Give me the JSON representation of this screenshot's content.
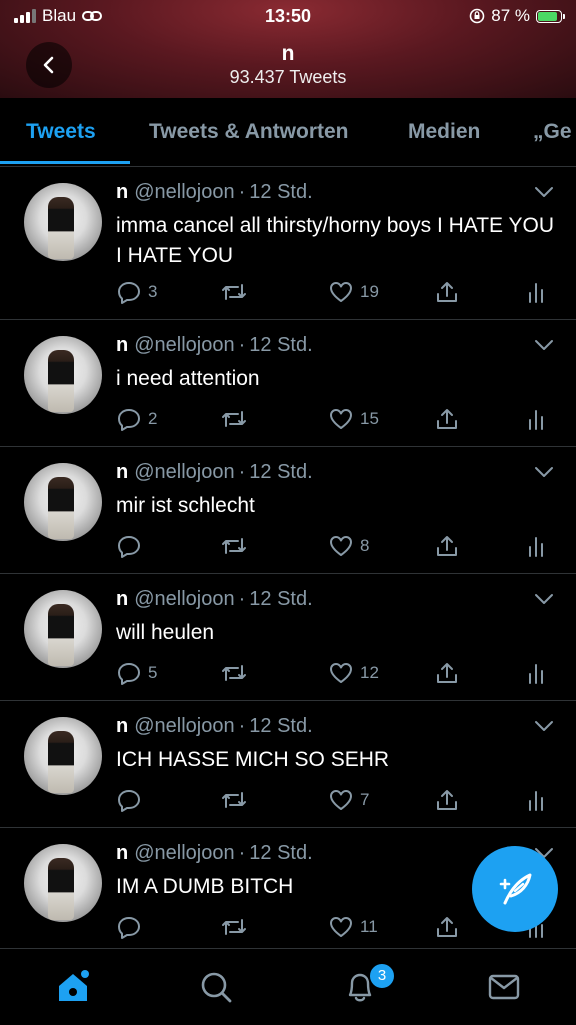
{
  "status_bar": {
    "carrier": "Blau",
    "time": "13:50",
    "battery_percent": "87 %",
    "battery_level": 0.87
  },
  "header": {
    "name": "n",
    "tweet_count": "93.437 Tweets",
    "back_icon": "chevron-left-icon"
  },
  "tabs": [
    {
      "label": "Tweets",
      "active": true
    },
    {
      "label": "Tweets & Antworten",
      "active": false
    },
    {
      "label": "Medien",
      "active": false
    },
    {
      "label": "„Ge",
      "active": false
    }
  ],
  "tweets": [
    {
      "name": "n",
      "handle": "@nellojoon",
      "sep": "·",
      "time": "12 Std.",
      "text": "imma cancel all thirsty/horny boys I HATE YOU I HATE YOU",
      "replies": "3",
      "retweets": "",
      "likes": "19"
    },
    {
      "name": "n",
      "handle": "@nellojoon",
      "sep": "·",
      "time": "12 Std.",
      "text": "i need attention",
      "replies": "2",
      "retweets": "",
      "likes": "15"
    },
    {
      "name": "n",
      "handle": "@nellojoon",
      "sep": "·",
      "time": "12 Std.",
      "text": "mir ist schlecht",
      "replies": "",
      "retweets": "",
      "likes": "8"
    },
    {
      "name": "n",
      "handle": "@nellojoon",
      "sep": "·",
      "time": "12 Std.",
      "text": "will heulen",
      "replies": "5",
      "retweets": "",
      "likes": "12"
    },
    {
      "name": "n",
      "handle": "@nellojoon",
      "sep": "·",
      "time": "12 Std.",
      "text": "ICH HASSE MICH SO SEHR",
      "replies": "",
      "retweets": "",
      "likes": "7"
    },
    {
      "name": "n",
      "handle": "@nellojoon",
      "sep": "·",
      "time": "12 Std.",
      "text": "IM A DUMB BITCH",
      "replies": "",
      "retweets": "",
      "likes": "11"
    }
  ],
  "fab": {
    "icon": "compose-feather-icon"
  },
  "tab_bar": {
    "items": [
      "home-icon",
      "search-icon",
      "notifications-icon",
      "messages-icon"
    ],
    "notification_badge": "3"
  },
  "colors": {
    "accent": "#1da1f2",
    "muted": "#8899a6",
    "battery": "#4cd964"
  }
}
